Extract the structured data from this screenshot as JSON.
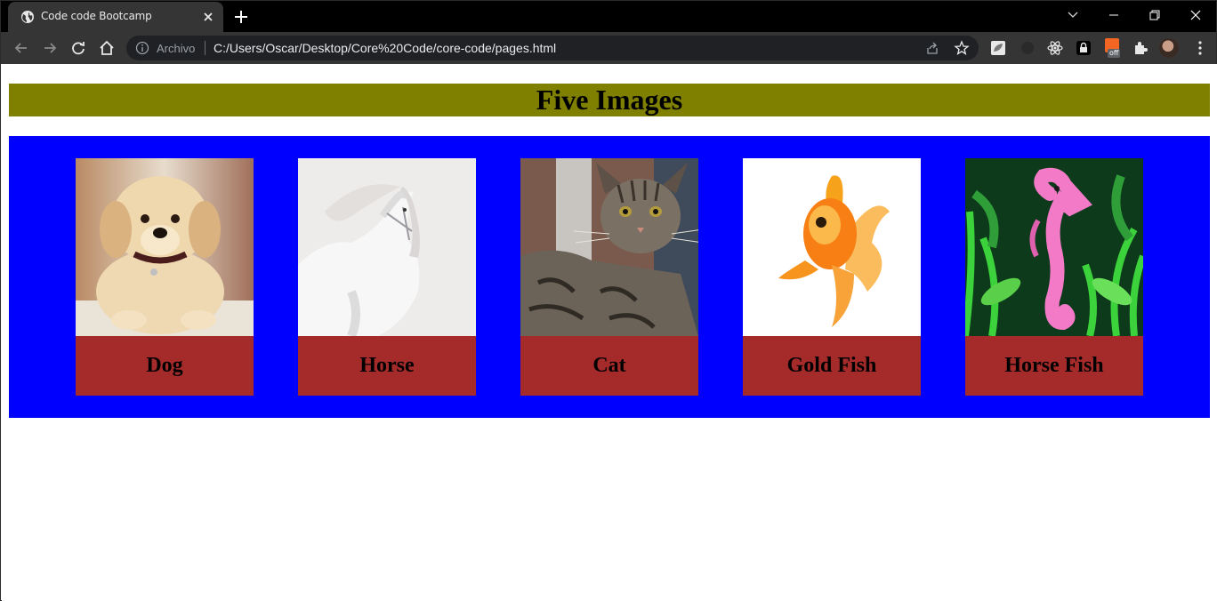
{
  "browser": {
    "tab_title": "Code code Bootcamp",
    "omnibox": {
      "scheme_label": "Archivo",
      "url": "C:/Users/Oscar/Desktop/Core%20Code/core-code/pages.html"
    },
    "extension_badge": "off"
  },
  "page": {
    "heading": "Five Images",
    "heading_bg": "#808000",
    "gallery_bg": "#0000ff",
    "caption_bg": "#a52a2a",
    "cards": [
      {
        "label": "Dog",
        "image": "golden-retriever-puppy"
      },
      {
        "label": "Horse",
        "image": "white-horse"
      },
      {
        "label": "Cat",
        "image": "tabby-cat"
      },
      {
        "label": "Gold Fish",
        "image": "goldfish"
      },
      {
        "label": "Horse Fish",
        "image": "pink-seahorse"
      }
    ]
  }
}
